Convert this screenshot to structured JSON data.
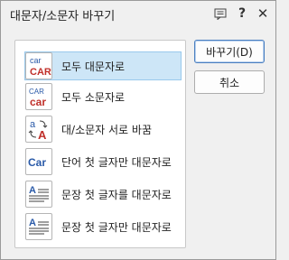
{
  "window": {
    "title": "대문자/소문자 바꾸기"
  },
  "titlebar_buttons": {
    "help_label": "?",
    "close_label": "✕"
  },
  "options": [
    {
      "label": "모두 대문자로",
      "icon": "car-to-CAR-icon",
      "selected": true
    },
    {
      "label": "모두 소문자로",
      "icon": "CAR-to-car-icon",
      "selected": false
    },
    {
      "label": "대/소문자 서로 바꿈",
      "icon": "swap-case-icon",
      "selected": false
    },
    {
      "label": "단어 첫 글자만 대문자로",
      "icon": "capitalize-word-icon",
      "selected": false
    },
    {
      "label": "문장 첫 글자를 대문자로",
      "icon": "sentence-case-icon",
      "selected": false
    },
    {
      "label": "문장 첫 글자만 대문자로",
      "icon": "sentence-case-only-icon",
      "selected": false
    }
  ],
  "buttons": {
    "change_label": "바꾸기(D)",
    "cancel_label": "취소"
  },
  "icon_text": {
    "lower": "car",
    "upper": "CAR",
    "capital": "Car",
    "a_lower": "a",
    "a_upper": "A"
  },
  "colors": {
    "selection_bg": "#cde6f7",
    "selection_border": "#99c9ec",
    "icon_blue": "#2a5aa8",
    "icon_red": "#c0302a",
    "default_button_border": "#4a7fc0"
  }
}
